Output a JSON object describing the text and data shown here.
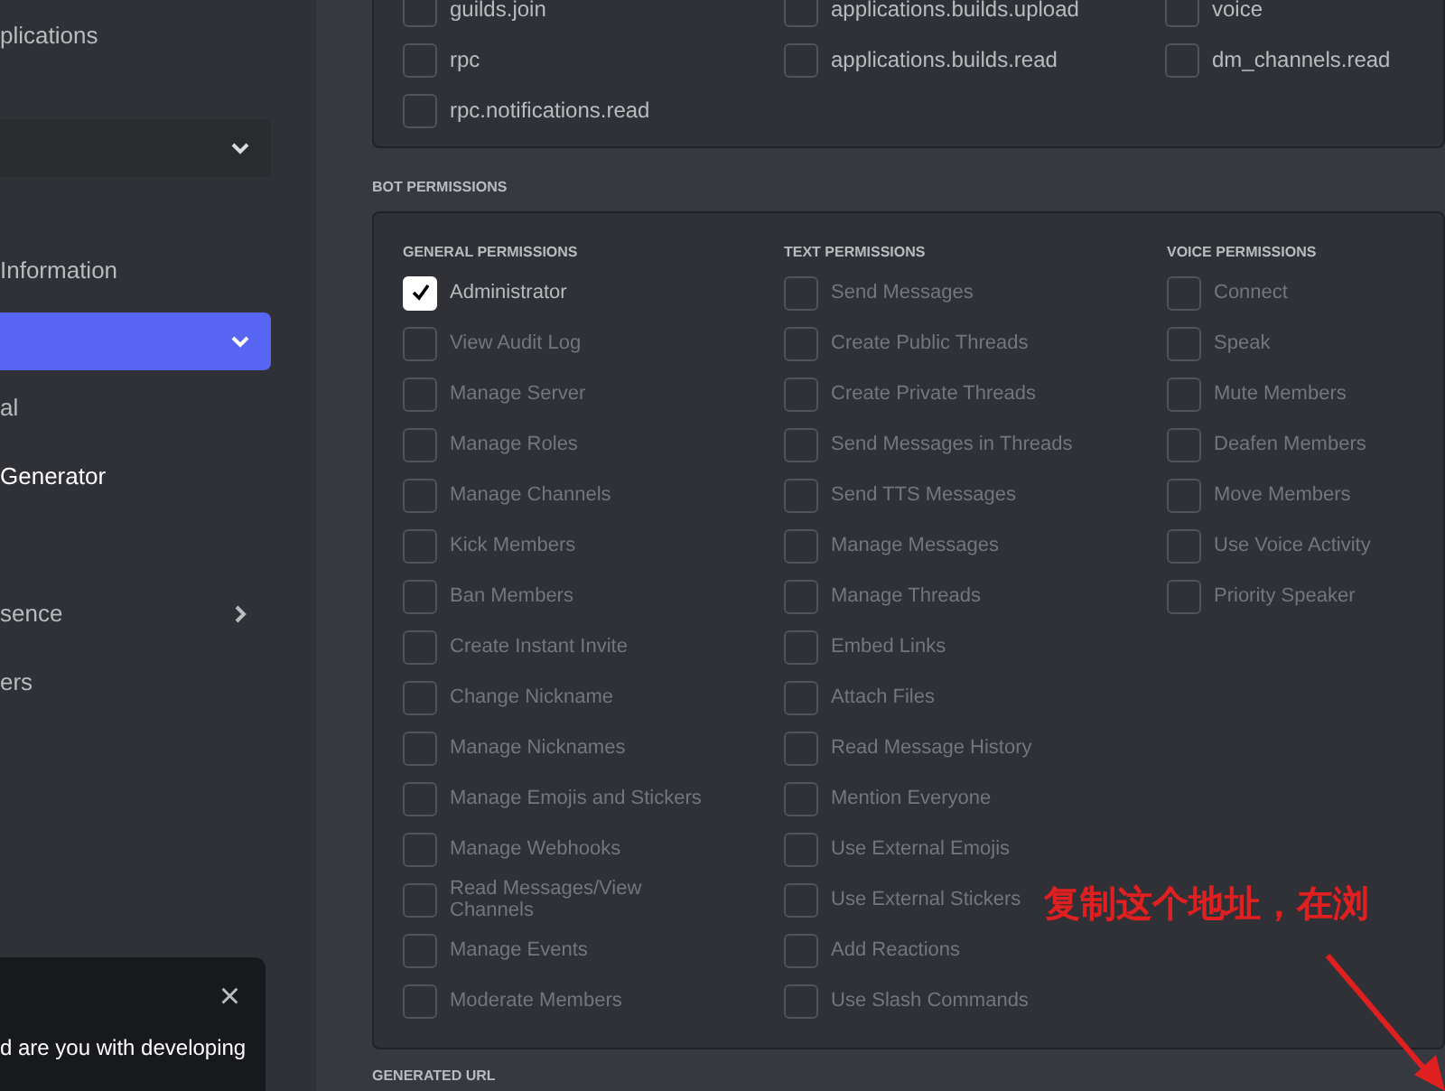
{
  "sidebar": {
    "items": [
      {
        "label": "plications",
        "kind": "link",
        "selected": false
      },
      {
        "kind": "dropdown",
        "selected": false
      },
      {
        "label": "Information",
        "kind": "link",
        "selected": false
      },
      {
        "kind": "dropdown",
        "selected": true
      },
      {
        "label": "al",
        "kind": "link",
        "selected": false
      },
      {
        "label": "Generator",
        "kind": "link",
        "selected": true
      },
      {
        "label": "sence",
        "kind": "expander",
        "selected": false
      },
      {
        "label": "ers",
        "kind": "link",
        "selected": false
      }
    ],
    "popup": {
      "close": "×",
      "text": "d are you with developing"
    }
  },
  "scopes": {
    "rows": [
      [
        {
          "label": "guilds.join",
          "checked": false
        },
        {
          "label": "applications.builds.upload",
          "checked": false
        },
        {
          "label": "voice",
          "checked": false
        }
      ],
      [
        {
          "label": "rpc",
          "checked": false
        },
        {
          "label": "applications.builds.read",
          "checked": false
        },
        {
          "label": "dm_channels.read",
          "checked": false
        }
      ],
      [
        {
          "label": "rpc.notifications.read",
          "checked": false
        }
      ]
    ]
  },
  "bot_permissions": {
    "title": "BOT PERMISSIONS",
    "groups": [
      {
        "title": "GENERAL PERMISSIONS",
        "items": [
          {
            "label": "Administrator",
            "checked": true,
            "disabled": false
          },
          {
            "label": "View Audit Log",
            "checked": false,
            "disabled": true
          },
          {
            "label": "Manage Server",
            "checked": false,
            "disabled": true
          },
          {
            "label": "Manage Roles",
            "checked": false,
            "disabled": true
          },
          {
            "label": "Manage Channels",
            "checked": false,
            "disabled": true
          },
          {
            "label": "Kick Members",
            "checked": false,
            "disabled": true
          },
          {
            "label": "Ban Members",
            "checked": false,
            "disabled": true
          },
          {
            "label": "Create Instant Invite",
            "checked": false,
            "disabled": true
          },
          {
            "label": "Change Nickname",
            "checked": false,
            "disabled": true
          },
          {
            "label": "Manage Nicknames",
            "checked": false,
            "disabled": true
          },
          {
            "label": "Manage Emojis and Stickers",
            "checked": false,
            "disabled": true
          },
          {
            "label": "Manage Webhooks",
            "checked": false,
            "disabled": true
          },
          {
            "label": "Read Messages/View Channels",
            "checked": false,
            "disabled": true
          },
          {
            "label": "Manage Events",
            "checked": false,
            "disabled": true
          },
          {
            "label": "Moderate Members",
            "checked": false,
            "disabled": true
          }
        ]
      },
      {
        "title": "TEXT PERMISSIONS",
        "items": [
          {
            "label": "Send Messages",
            "checked": false,
            "disabled": true
          },
          {
            "label": "Create Public Threads",
            "checked": false,
            "disabled": true
          },
          {
            "label": "Create Private Threads",
            "checked": false,
            "disabled": true
          },
          {
            "label": "Send Messages in Threads",
            "checked": false,
            "disabled": true
          },
          {
            "label": "Send TTS Messages",
            "checked": false,
            "disabled": true
          },
          {
            "label": "Manage Messages",
            "checked": false,
            "disabled": true
          },
          {
            "label": "Manage Threads",
            "checked": false,
            "disabled": true
          },
          {
            "label": "Embed Links",
            "checked": false,
            "disabled": true
          },
          {
            "label": "Attach Files",
            "checked": false,
            "disabled": true
          },
          {
            "label": "Read Message History",
            "checked": false,
            "disabled": true
          },
          {
            "label": "Mention Everyone",
            "checked": false,
            "disabled": true
          },
          {
            "label": "Use External Emojis",
            "checked": false,
            "disabled": true
          },
          {
            "label": "Use External Stickers",
            "checked": false,
            "disabled": true
          },
          {
            "label": "Add Reactions",
            "checked": false,
            "disabled": true
          },
          {
            "label": "Use Slash Commands",
            "checked": false,
            "disabled": true
          }
        ]
      },
      {
        "title": "VOICE PERMISSIONS",
        "items": [
          {
            "label": "Connect",
            "checked": false,
            "disabled": true
          },
          {
            "label": "Speak",
            "checked": false,
            "disabled": true
          },
          {
            "label": "Mute Members",
            "checked": false,
            "disabled": true
          },
          {
            "label": "Deafen Members",
            "checked": false,
            "disabled": true
          },
          {
            "label": "Move Members",
            "checked": false,
            "disabled": true
          },
          {
            "label": "Use Voice Activity",
            "checked": false,
            "disabled": true
          },
          {
            "label": "Priority Speaker",
            "checked": false,
            "disabled": true
          }
        ]
      }
    ]
  },
  "generated_url": {
    "title": "GENERATED URL"
  },
  "annotation": {
    "text": "复制这个地址，在浏"
  }
}
